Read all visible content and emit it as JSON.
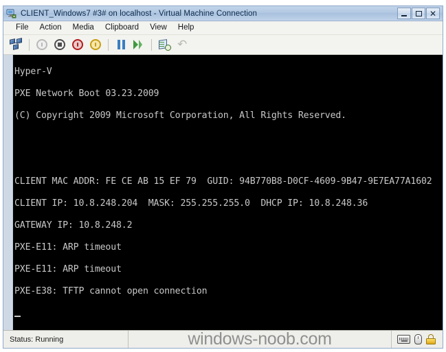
{
  "window": {
    "title": "CLIENT_Windows7 #3# on localhost - Virtual Machine Connection",
    "icon": "virtual-machine-icon",
    "controls": {
      "minimize": "_",
      "maximize": "□",
      "close": "✕"
    }
  },
  "menu": {
    "items": [
      {
        "label": "File"
      },
      {
        "label": "Action"
      },
      {
        "label": "Media"
      },
      {
        "label": "Clipboard"
      },
      {
        "label": "View"
      },
      {
        "label": "Help"
      }
    ]
  },
  "toolbar": {
    "buttons": [
      {
        "name": "connect-network-icon",
        "tooltip": "Connect"
      },
      {
        "name": "power-off-icon",
        "tooltip": "Turn Off"
      },
      {
        "name": "shut-down-icon",
        "tooltip": "Shut Down"
      },
      {
        "name": "power-start-icon",
        "tooltip": "Start"
      },
      {
        "name": "save-state-icon",
        "tooltip": "Save"
      },
      {
        "name": "pause-icon",
        "tooltip": "Pause"
      },
      {
        "name": "resume-icon",
        "tooltip": "Resume"
      },
      {
        "name": "snapshot-icon",
        "tooltip": "Snapshot"
      },
      {
        "name": "revert-icon",
        "tooltip": "Revert"
      }
    ]
  },
  "console": {
    "lines": [
      "Hyper-V",
      "PXE Network Boot 03.23.2009",
      "(C) Copyright 2009 Microsoft Corporation, All Rights Reserved.",
      "",
      "",
      "CLIENT MAC ADDR: FE CE AB 15 EF 79  GUID: 94B770B8-D0CF-4609-9B47-9E7EA77A1602",
      "CLIENT IP: 10.8.248.204  MASK: 255.255.255.0  DHCP IP: 10.8.248.36",
      "GATEWAY IP: 10.8.248.2",
      "PXE-E11: ARP timeout",
      "PXE-E11: ARP timeout",
      "PXE-E38: TFTP cannot open connection"
    ],
    "cursor_visible": true,
    "background_color": "#000000",
    "text_color": "#c8c8c8"
  },
  "statusbar": {
    "status_label": "Status: Running",
    "watermark": "windows-noob.com",
    "icons": [
      {
        "name": "keyboard-icon"
      },
      {
        "name": "mouse-icon"
      },
      {
        "name": "lock-icon",
        "color": "#e0a81a"
      }
    ]
  }
}
